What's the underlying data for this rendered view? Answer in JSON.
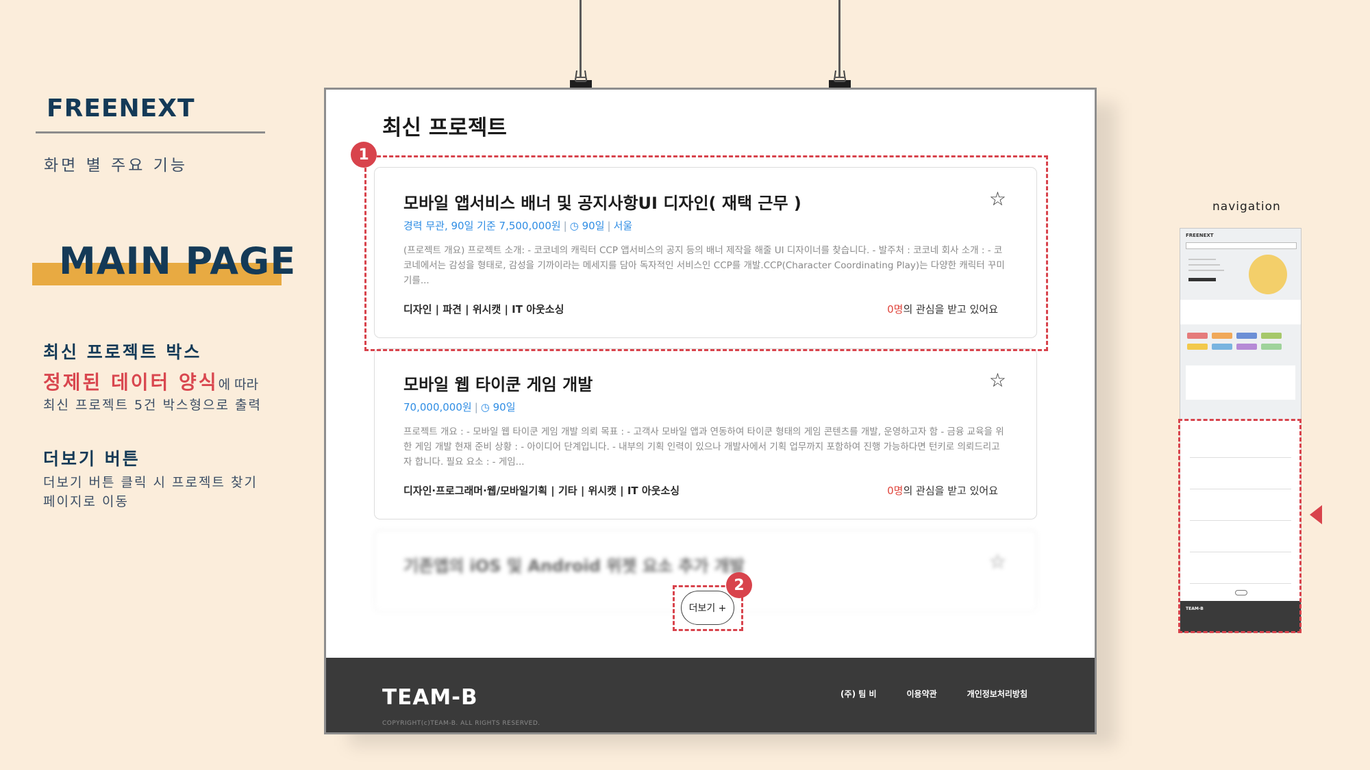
{
  "left_panel": {
    "brand": "FREENEXT",
    "subtitle": "화면 별 주요 기능",
    "page_name": "MAIN PAGE",
    "section1": {
      "heading": "최신 프로젝트 박스",
      "highlight": "정제된 데이터 양식",
      "highlight_suffix": "에 따라",
      "line2": "최신 프로젝트 5건 박스형으로 출력"
    },
    "section2": {
      "heading": "더보기 버튼",
      "line1": "더보기 버튼 클릭 시 프로젝트 찾기",
      "line2": "페이지로 이동"
    }
  },
  "screen": {
    "title": "최신 프로젝트",
    "projects": [
      {
        "title": "모바일 앱서비스 배너 및 공지사항UI 디자인( 재택 근무 )",
        "meta": "경력 무관, 90일 기준 7,500,000원",
        "duration": "90일",
        "location": "서울",
        "desc": "(프로젝트 개요) 프로젝트 소개: - 코코네의 캐릭터 CCP 앱서비스의 공지 등의 배너 제작을 해줄 UI 디자이너를 찾습니다. - 발주처 : 코코네 회사 소개 : - 코코네에서는 감성을 형태로, 감성을 기까이라는 메세지를 담아 독자적인 서비스인 CCP를 개발.CCP(Character Coordinating Play)는 다양한 캐릭터 꾸미기를...",
        "tags": "디자인 | 파견 | 위시캣 | IT 아웃소싱",
        "interest_count": "0명",
        "interest_text": "의 관심을 받고 있어요"
      },
      {
        "title": "모바일 웹 타이쿤 게임 개발",
        "meta": "70,000,000원",
        "duration": "90일",
        "location": "",
        "desc": "프로젝트 개요 : - 모바일 웹 타이쿤 게임 개발 의뢰 목표 : - 고객사 모바일 앱과 연동하여 타이쿤 형태의 게임 콘텐츠를 개발, 운영하고자 함 - 금융 교육을 위한 게임 개발 현재 준비 상황 : - 아이디어 단계입니다. - 내부의 기획 인력이 있으나 개발사에서 기획 업무까지 포함하여 진행 가능하다면 턴키로 의뢰드리고자 합니다. 필요 요소 : - 게임...",
        "tags": "디자인·프로그래머·웹/모바일기획 | 기타 | 위시캣 | IT 아웃소싱",
        "interest_count": "0명",
        "interest_text": "의 관심을 받고 있어요"
      },
      {
        "title": "기존앱의 iOS 및 Android 위젯 요소 추가 개발"
      }
    ],
    "more_button": "더보기 +",
    "badges": [
      "1",
      "2"
    ],
    "footer": {
      "logo": "TEAM-B",
      "copyright": "COPYRIGHT(c)TEAM-B. ALL RIGHTS RESERVED.",
      "links": [
        "(주) 팀 비",
        "이용약관",
        "개인정보처리방침"
      ]
    }
  },
  "navigation": {
    "label": "navigation",
    "mini_logo": "FREENEXT",
    "mini_footer_logo": "TEAM-B"
  },
  "colors": {
    "background": "#fbeddb",
    "navy": "#143a57",
    "accent_bar": "#e8aa42",
    "highlight_red": "#d8434c",
    "link_blue": "#2f8de4",
    "footer": "#3a3a3a"
  }
}
